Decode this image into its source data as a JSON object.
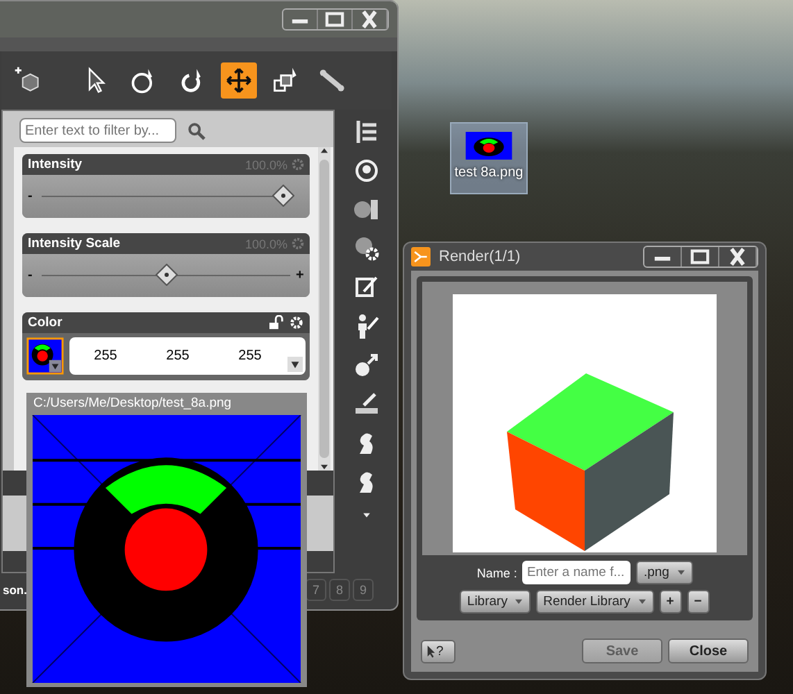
{
  "main_window": {
    "tools": [
      {
        "kind": "add-node",
        "selected": false
      },
      {
        "kind": "select",
        "selected": false
      },
      {
        "kind": "orbit",
        "selected": false
      },
      {
        "kind": "rotate",
        "selected": false
      },
      {
        "kind": "move",
        "selected": true
      },
      {
        "kind": "scale",
        "selected": false
      },
      {
        "kind": "bone",
        "selected": false
      }
    ],
    "filter": {
      "placeholder": "Enter text to filter by..."
    },
    "properties": [
      {
        "kind": "slider",
        "label": "Intensity",
        "reading": "100.0%",
        "level": 0.97,
        "min_sign": "-"
      },
      {
        "kind": "slider",
        "label": "Intensity Scale",
        "reading": "100.0%",
        "level": 0.5,
        "min_sign": "-",
        "max_sign": "+"
      },
      {
        "kind": "color",
        "label": "Color",
        "values": [
          "255",
          "255",
          "255"
        ]
      }
    ],
    "tooltip": {
      "path": "C:/Users/Me/Desktop/test_8a.png"
    },
    "status_text": "son.",
    "page_buttons": [
      "7",
      "8",
      "9"
    ]
  },
  "desktop_icon": {
    "label": "test 8a.png"
  },
  "render_window": {
    "title": "Render(1/1)",
    "name_label": "Name :",
    "name_placeholder": "Enter a name f...",
    "format": ".png",
    "library": "Library",
    "render_library": "Render Library",
    "add": "+",
    "remove": "−",
    "help": "?",
    "buttons": [
      {
        "label": "Save",
        "disabled": true
      },
      {
        "label": "Close",
        "disabled": false
      }
    ]
  }
}
